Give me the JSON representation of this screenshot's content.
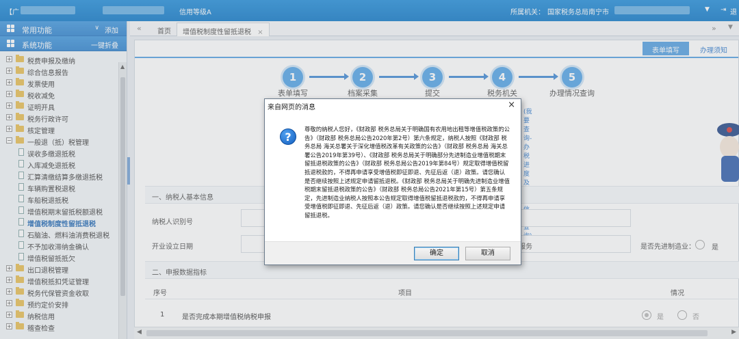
{
  "topbar": {
    "bracket": "【广",
    "user_role": "信用等级A",
    "org_label": "所属机关：",
    "org_value": "国家税务总局南宁市",
    "exit_label": "退"
  },
  "sidebar": {
    "common_label": "常用功能",
    "add_label": "添加",
    "system_label": "系统功能",
    "collapse_label": "一键折叠",
    "items": [
      {
        "label": "税费申报及缴纳",
        "type": "folder"
      },
      {
        "label": "综合信息报告",
        "type": "folder"
      },
      {
        "label": "发票使用",
        "type": "folder"
      },
      {
        "label": "税收减免",
        "type": "folder"
      },
      {
        "label": "证明开具",
        "type": "folder"
      },
      {
        "label": "税务行政许可",
        "type": "folder"
      },
      {
        "label": "核定管理",
        "type": "folder"
      },
      {
        "label": "一般退（抵）税管理",
        "type": "folder-open"
      },
      {
        "label": "误收多缴退抵税",
        "type": "doc"
      },
      {
        "label": "入库减免退抵税",
        "type": "doc"
      },
      {
        "label": "汇算清缴结算多缴退抵税",
        "type": "doc"
      },
      {
        "label": "车辆购置税退税",
        "type": "doc"
      },
      {
        "label": "车船税退抵税",
        "type": "doc"
      },
      {
        "label": "增值税期末留抵税额退税",
        "type": "doc"
      },
      {
        "label": "增值税制度性留抵退税",
        "type": "doc-selected"
      },
      {
        "label": "石脑油、燃料油消费税退税",
        "type": "doc"
      },
      {
        "label": "不予加收滞纳金确认",
        "type": "doc"
      },
      {
        "label": "增值税留抵抵欠",
        "type": "doc"
      },
      {
        "label": "出口退税管理",
        "type": "folder"
      },
      {
        "label": "增值税抵扣凭证管理",
        "type": "folder"
      },
      {
        "label": "税务代保管资金收取",
        "type": "folder"
      },
      {
        "label": "预约定价安排",
        "type": "folder"
      },
      {
        "label": "纳税信用",
        "type": "folder"
      },
      {
        "label": "稽查检查",
        "type": "folder"
      }
    ]
  },
  "tabs": {
    "home": "首页",
    "current": "增值税制度性留抵退税",
    "close": "×",
    "nav_left": "«",
    "nav_right": "»"
  },
  "right_tabs": {
    "form_fill": "表单填写",
    "guide": "办理须知"
  },
  "steps": [
    {
      "num": "1",
      "label": "表单填写"
    },
    {
      "num": "2",
      "label": "档案采集"
    },
    {
      "num": "3",
      "label": "提交"
    },
    {
      "num": "4",
      "label": "税务机关"
    },
    {
      "num": "5",
      "label": "办理情况查询"
    }
  ],
  "steps_link": "(我要查询-办税进度及结果信息查询)",
  "section1": {
    "title": "一、纳税人基本信息",
    "taxpayer_id_label": "纳税人识别号",
    "established_label": "开业设立日期",
    "industry_partial": "服务",
    "advanced_mfg_label": "是否先进制造业：",
    "yes_label": "是"
  },
  "section2": {
    "title": "二、申报数据指标",
    "col_no": "序号",
    "col_item": "项目",
    "col_status": "情况",
    "row1_no": "1",
    "row1_item": "是否完成本期增值税纳税申报",
    "yes_label": "是",
    "no_label": "否"
  },
  "dialog": {
    "title": "来自网页的消息",
    "close": "×",
    "icon": "?",
    "message": "尊敬的纳税人您好，《财政部 税务总局关于明确国有农用地出租等增值税政策的公告》（财政部 税务总局公告2020年第2号）第六条规定，纳税人按照《财政部 税务总局 海关总署关于深化增值税改革有关政策的公告》（财政部 税务总局 海关总署公告2019年第39号）、《财政部 税务总局关于明确部分先进制造业增值税期末留抵退税政策的公告》（财政部 税务总局公告2019年第84号）规定取得增值税留抵退税款的，不得再申请享受增值税即征即退、先征后返（退）政策。请您确认是否继续按照上述规定申请留抵退税。《财政部 税务总局关于明确先进制造业增值税期末留抵退税政策的公告》（财政部 税务总局公告2021年第15号）第五条规定，先进制造业纳税人按照本公告规定取得增值税留抵退税款的，不得再申请享受增值税即征即退、先征后返（退）政策。请您确认是否继续按照上述规定申请留抵退税。",
    "ok": "确定",
    "cancel": "取消"
  },
  "colors": {
    "topbar": "#1b7fcb",
    "step": "#5aa8e8",
    "link": "#3b82d0"
  }
}
